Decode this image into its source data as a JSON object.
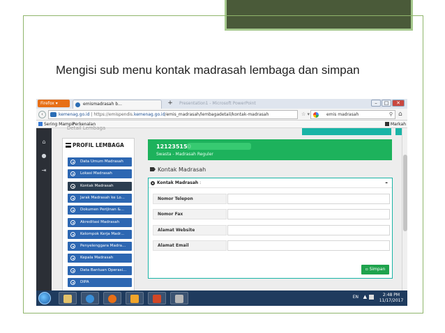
{
  "slide": {
    "title": "Mengisi sub menu kontak madrasah lembaga dan simpan",
    "accent": "#8fb56b"
  },
  "browser": {
    "app_button": "Firefox",
    "tab_title": "emismadrasah b...",
    "new_tab": "+",
    "bg_tab_title": "Presentation1 - Microsoft PowerPoint",
    "url_site": "kemenag.go.id",
    "url_full_prefix": "https://emispendis.",
    "url_domain": "kemenag.go.id",
    "url_path": "/emis_madrasah/lembagadetail/kontak-madrasah",
    "search_value": "emis madrasah",
    "bookmarks": [
      "Sering Mampir",
      "Perkenalan"
    ],
    "bookmarks_right": "Markah"
  },
  "app": {
    "breadcrumb": "Detail Lembaga",
    "sidebar_title": "PROFIL LEMBAGA",
    "menu": [
      {
        "label": "Data Umum Madrasah",
        "active": false
      },
      {
        "label": "Lokasi Madrasah",
        "active": false
      },
      {
        "label": "Kontak Madrasah",
        "active": true
      },
      {
        "label": "Jarak Madrasah ke Lo...",
        "active": false
      },
      {
        "label": "Dokumen Perijinan &...",
        "active": false
      },
      {
        "label": "Akreditasi Madrasah",
        "active": false
      },
      {
        "label": "Kelompok Kerja Madr...",
        "active": false
      },
      {
        "label": "Penyelenggara Madra...",
        "active": false
      },
      {
        "label": "Kepala Madrasah",
        "active": false
      },
      {
        "label": "Data Bantuan Operasi...",
        "active": false
      },
      {
        "label": "DIPA",
        "active": false
      }
    ],
    "banner": {
      "id": "121235150",
      "subtitle": "Swasta - Madrasah Reguler",
      "color": "#1db25c"
    },
    "section_title": "Kontak Madrasah",
    "panel": {
      "title": "Kontak Madrasah",
      "title_suffix": " :",
      "collapse": "-",
      "fields": [
        {
          "label": "Nomor Telepon",
          "value": ""
        },
        {
          "label": "Nomor Fax",
          "value": ""
        },
        {
          "label": "Alamat Website",
          "value": ""
        },
        {
          "label": "Alamat Email",
          "value": ""
        }
      ],
      "save_label": "Simpan"
    }
  },
  "taskbar": {
    "lang": "EN",
    "time": "2:48 PM",
    "date": "11/17/2017"
  }
}
